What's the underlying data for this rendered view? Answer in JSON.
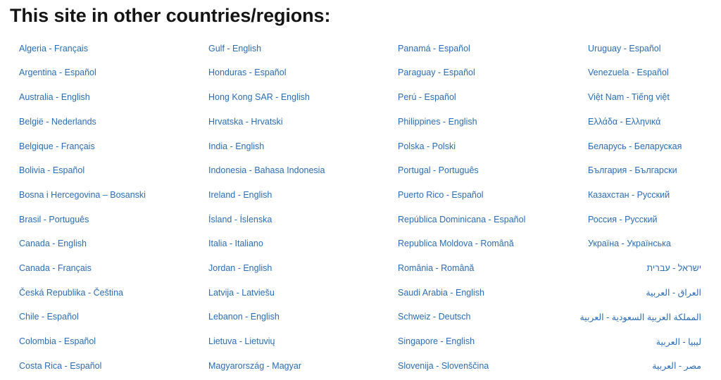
{
  "page": {
    "heading": "This site in other countries/regions:",
    "background_color": "#ffffff",
    "link_color": "#2b6cb4",
    "heading_color": "#151515"
  },
  "columns": [
    {
      "name": "column-1",
      "items": [
        {
          "label": "Algeria - Français",
          "dir": "ltr"
        },
        {
          "label": "Argentina - Español",
          "dir": "ltr"
        },
        {
          "label": "Australia - English",
          "dir": "ltr"
        },
        {
          "label": "België - Nederlands",
          "dir": "ltr"
        },
        {
          "label": "Belgique - Français",
          "dir": "ltr"
        },
        {
          "label": "Bolivia - Español",
          "dir": "ltr"
        },
        {
          "label": "Bosna i Hercegovina – Bosanski",
          "dir": "ltr"
        },
        {
          "label": "Brasil - Português",
          "dir": "ltr"
        },
        {
          "label": "Canada - English",
          "dir": "ltr"
        },
        {
          "label": "Canada - Français",
          "dir": "ltr"
        },
        {
          "label": "Česká Republika - Čeština",
          "dir": "ltr"
        },
        {
          "label": "Chile - Español",
          "dir": "ltr"
        },
        {
          "label": "Colombia - Español",
          "dir": "ltr"
        },
        {
          "label": "Costa Rica - Español",
          "dir": "ltr"
        }
      ]
    },
    {
      "name": "column-2",
      "items": [
        {
          "label": "Gulf - English",
          "dir": "ltr"
        },
        {
          "label": "Honduras - Español",
          "dir": "ltr"
        },
        {
          "label": "Hong Kong SAR - English",
          "dir": "ltr"
        },
        {
          "label": "Hrvatska - Hrvatski",
          "dir": "ltr"
        },
        {
          "label": "India - English",
          "dir": "ltr"
        },
        {
          "label": "Indonesia - Bahasa Indonesia",
          "dir": "ltr"
        },
        {
          "label": "Ireland - English",
          "dir": "ltr"
        },
        {
          "label": "Ísland - Íslenska",
          "dir": "ltr"
        },
        {
          "label": "Italia - Italiano",
          "dir": "ltr"
        },
        {
          "label": "Jordan - English",
          "dir": "ltr"
        },
        {
          "label": "Latvija - Latviešu",
          "dir": "ltr"
        },
        {
          "label": "Lebanon - English",
          "dir": "ltr"
        },
        {
          "label": "Lietuva - Lietuvių",
          "dir": "ltr"
        },
        {
          "label": "Magyarország - Magyar",
          "dir": "ltr"
        }
      ]
    },
    {
      "name": "column-3",
      "items": [
        {
          "label": "Panamá - Español",
          "dir": "ltr"
        },
        {
          "label": "Paraguay - Español",
          "dir": "ltr"
        },
        {
          "label": "Perú - Español",
          "dir": "ltr"
        },
        {
          "label": "Philippines - English",
          "dir": "ltr"
        },
        {
          "label": "Polska - Polski",
          "dir": "ltr"
        },
        {
          "label": "Portugal - Português",
          "dir": "ltr"
        },
        {
          "label": "Puerto Rico - Español",
          "dir": "ltr"
        },
        {
          "label": "República Dominicana - Español",
          "dir": "ltr"
        },
        {
          "label": "Republica Moldova - Română",
          "dir": "ltr"
        },
        {
          "label": "România - Română",
          "dir": "ltr"
        },
        {
          "label": "Saudi Arabia - English",
          "dir": "ltr"
        },
        {
          "label": "Schweiz - Deutsch",
          "dir": "ltr"
        },
        {
          "label": "Singapore - English",
          "dir": "ltr"
        },
        {
          "label": "Slovenija - Slovenščina",
          "dir": "ltr"
        }
      ]
    },
    {
      "name": "column-4",
      "items": [
        {
          "label": "Uruguay - Español",
          "dir": "ltr"
        },
        {
          "label": "Venezuela - Español",
          "dir": "ltr"
        },
        {
          "label": "Việt Nam - Tiếng việt",
          "dir": "ltr"
        },
        {
          "label": "Ελλάδα - Ελληνικά",
          "dir": "ltr"
        },
        {
          "label": "Беларусь - Беларуская",
          "dir": "ltr"
        },
        {
          "label": "България - Български",
          "dir": "ltr"
        },
        {
          "label": "Казахстан - Русский",
          "dir": "ltr"
        },
        {
          "label": "Россия - Русский",
          "dir": "ltr"
        },
        {
          "label": "Україна - Українська",
          "dir": "ltr"
        },
        {
          "label": "ישראל - עברית",
          "dir": "rtl"
        },
        {
          "label": "العراق - العربية",
          "dir": "rtl"
        },
        {
          "label": "المملكة العربية السعودية - العربية",
          "dir": "rtl"
        },
        {
          "label": "ليبيا - العربية",
          "dir": "rtl"
        },
        {
          "label": "مصر - العربية",
          "dir": "rtl"
        }
      ]
    }
  ]
}
